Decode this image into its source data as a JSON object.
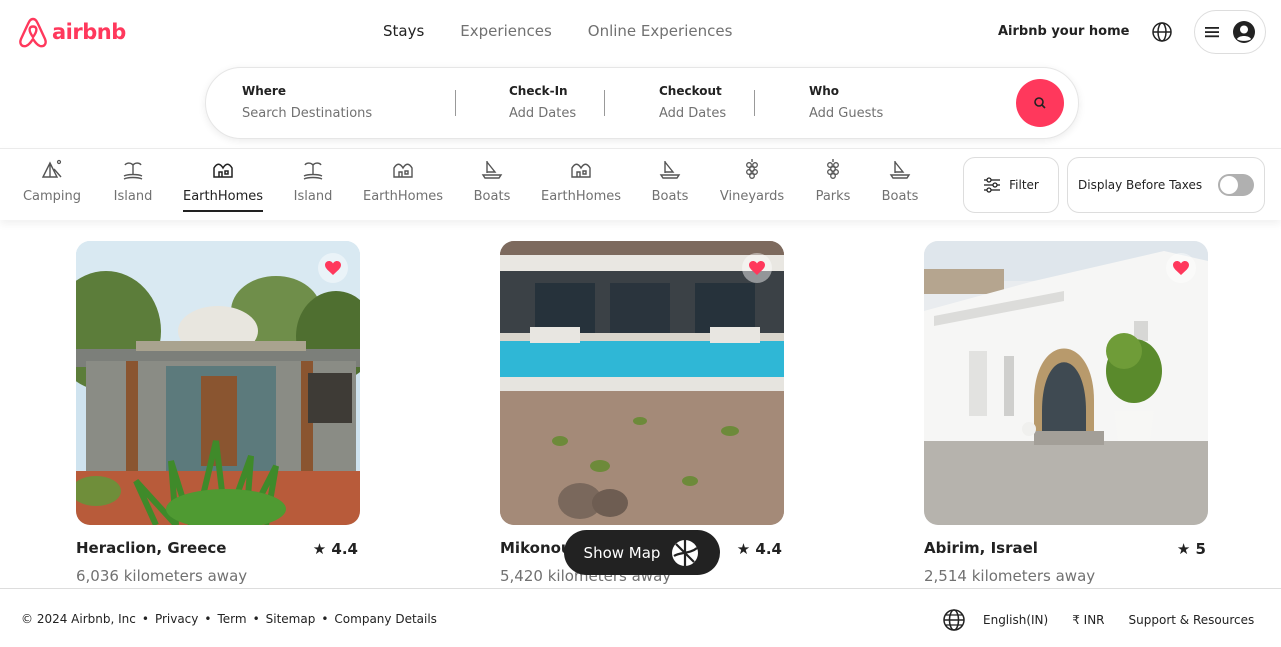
{
  "header": {
    "logo_text": "airbnb",
    "tabs": [
      {
        "label": "Stays",
        "active": true
      },
      {
        "label": "Experiences",
        "active": false
      },
      {
        "label": "Online Experiences",
        "active": false
      }
    ],
    "host_link": "Airbnb your home"
  },
  "search": {
    "where_label": "Where",
    "where_placeholder": "Search Destinations",
    "checkin_label": "Check-In",
    "checkin_value": "Add Dates",
    "checkout_label": "Checkout",
    "checkout_value": "Add Dates",
    "who_label": "Who",
    "who_value": "Add Guests"
  },
  "categories": [
    {
      "label": "Camping",
      "icon": "tent-icon",
      "active": false
    },
    {
      "label": "Island",
      "icon": "island-icon",
      "active": false
    },
    {
      "label": "EarthHomes",
      "icon": "earthhome-icon",
      "active": true
    },
    {
      "label": "Island",
      "icon": "island-icon",
      "active": false
    },
    {
      "label": "EarthHomes",
      "icon": "earthhome-icon",
      "active": false
    },
    {
      "label": "Boats",
      "icon": "boat-icon",
      "active": false
    },
    {
      "label": "EarthHomes",
      "icon": "earthhome-icon",
      "active": false
    },
    {
      "label": "Boats",
      "icon": "boat-icon",
      "active": false
    },
    {
      "label": "Vineyards",
      "icon": "grapes-icon",
      "active": false
    },
    {
      "label": "Parks",
      "icon": "grapes-icon",
      "active": false
    },
    {
      "label": "Boats",
      "icon": "boat-icon",
      "active": false
    }
  ],
  "filters": {
    "filter_label": "Filter",
    "taxes_label": "Display Before Taxes",
    "taxes_enabled": false
  },
  "listings": [
    {
      "title": "Heraclion, Greece",
      "rating": "★ 4.4",
      "distance": "6,036 kilometers away",
      "favorited": true
    },
    {
      "title": "Mikonou",
      "rating": "★ 4.4",
      "distance": "5,420 kilometers away",
      "favorited": true
    },
    {
      "title": "Abirim, Israel",
      "rating": "★ 5",
      "distance": "2,514 kilometers away",
      "favorited": true
    }
  ],
  "map_button": "Show Map",
  "footer": {
    "copyright": "© 2024 Airbnb, Inc",
    "links": [
      "Privacy",
      "Term",
      "Sitemap",
      "Company Details"
    ],
    "separator": "•",
    "language": "English(IN)",
    "currency": "₹ INR",
    "support": "Support & Resources"
  },
  "colors": {
    "brand": "#FF385C",
    "heart": "#FF385C",
    "text_primary": "#222222",
    "text_secondary": "#717171"
  }
}
